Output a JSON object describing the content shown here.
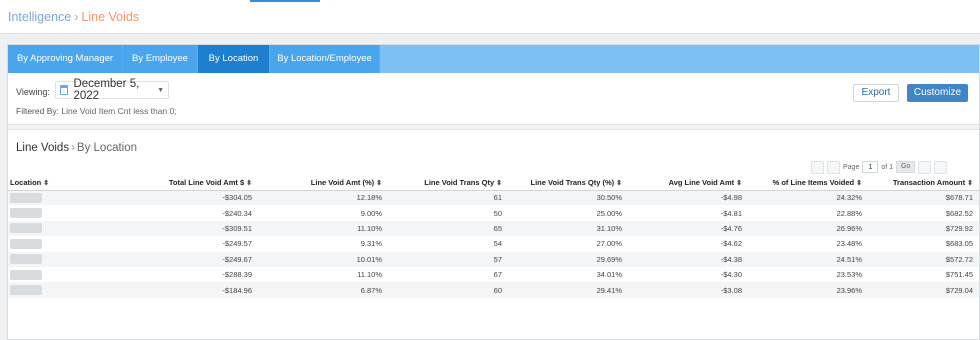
{
  "breadcrumb": {
    "root": "Intelligence",
    "separator": "›",
    "current": "Line Voids"
  },
  "tabs": [
    {
      "label": "By Approving Manager"
    },
    {
      "label": "By Employee"
    },
    {
      "label": "By Location"
    },
    {
      "label": "By Location/Employee"
    }
  ],
  "active_tab": "By Location",
  "view": {
    "viewing_label": "Viewing:",
    "date": "December 5, 2022",
    "filtered_label": "Filtered By:",
    "filter_value": "Line Void Item Cnt less than 0;"
  },
  "actions": {
    "export": "Export",
    "customize": "Customize"
  },
  "section": {
    "title": "Line Voids",
    "separator": "›",
    "subtitle": "By Location"
  },
  "pager": {
    "page_label": "Page",
    "page": "1",
    "of_label": "of 1",
    "go": "Go"
  },
  "table": {
    "headers": [
      "Location",
      "Total Line Void Amt $",
      "Line Void Amt (%)",
      "Line Void Trans Qty",
      "Line Void Trans Qty (%)",
      "Avg Line Void Amt",
      "% of Line Items Voided",
      "Transaction Amount"
    ],
    "rows": [
      [
        "",
        "-$304.05",
        "12.18%",
        "61",
        "30.50%",
        "-$4.98",
        "24.32%",
        "$678.71"
      ],
      [
        "",
        "-$240.34",
        "9.00%",
        "50",
        "25.00%",
        "-$4.81",
        "22.88%",
        "$682.52"
      ],
      [
        "",
        "-$309.51",
        "11.10%",
        "65",
        "31.10%",
        "-$4.76",
        "26.96%",
        "$729.92"
      ],
      [
        "",
        "-$249.57",
        "9.31%",
        "54",
        "27.00%",
        "-$4.62",
        "23.48%",
        "$683.05"
      ],
      [
        "",
        "-$249.67",
        "10.01%",
        "57",
        "29.69%",
        "-$4.38",
        "24.51%",
        "$572.72"
      ],
      [
        "",
        "-$288.39",
        "11.10%",
        "67",
        "34.01%",
        "-$4.30",
        "23.53%",
        "$751.45"
      ],
      [
        "",
        "-$184.96",
        "6.87%",
        "60",
        "29.41%",
        "-$3.08",
        "23.96%",
        "$729.04"
      ]
    ]
  },
  "colors": {
    "accent": "#1c7fd0",
    "tabbar": "#7cc0f4",
    "breadcrumb_current": "#f0956a"
  }
}
